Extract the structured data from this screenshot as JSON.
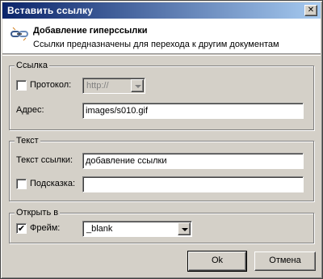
{
  "window": {
    "title": "Вставить ссылку",
    "close_glyph": "✕"
  },
  "header": {
    "icon": "chain-link-icon",
    "title": "Добавление гиперссылки",
    "subtitle": "Ссылки предназначены для перехода к другим документам"
  },
  "link_group": {
    "label": "Ссылка",
    "protocol": {
      "label": "Протокол:",
      "checked": false,
      "value": "http://",
      "enabled": false
    },
    "address": {
      "label": "Адрес:",
      "value": "images/s010.gif"
    }
  },
  "text_group": {
    "label": "Текст",
    "link_text": {
      "label": "Текст ссылки:",
      "value": "добавление ссылки"
    },
    "tooltip": {
      "label": "Подсказка:",
      "checked": false,
      "value": ""
    }
  },
  "open_group": {
    "label": "Открыть в",
    "frame": {
      "label": "Фрейм:",
      "checked": true,
      "check_glyph": "✔",
      "value": "_blank"
    }
  },
  "buttons": {
    "ok": "Ok",
    "cancel": "Отмена"
  },
  "colors": {
    "face": "#d4d0c8",
    "title_start": "#0a246a",
    "title_end": "#a6caf0"
  }
}
